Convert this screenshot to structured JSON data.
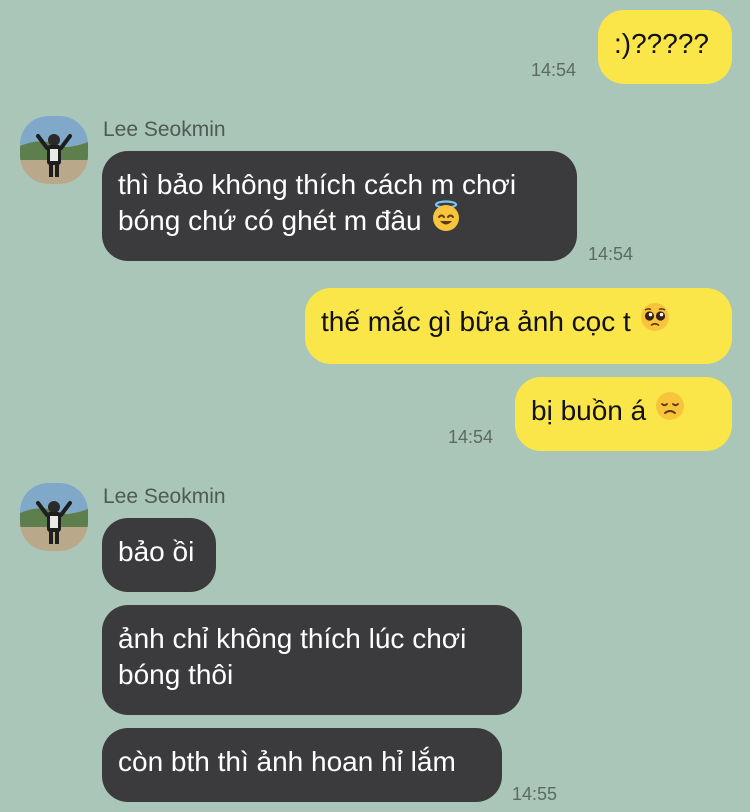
{
  "chat": {
    "messages": [
      {
        "text": ":)?????",
        "time": "14:54"
      },
      {
        "sender": "Lee Seokmin",
        "line1": "thì bảo không thích cách m chơi",
        "line2": "bóng chứ có ghét m đâu",
        "time": "14:54"
      },
      {
        "text": "thế mắc gì bữa ảnh cọc t"
      },
      {
        "text": "bị buồn á",
        "time": "14:54"
      },
      {
        "sender": "Lee Seokmin",
        "text": "bảo ồi"
      },
      {
        "line1": "ảnh chỉ không thích lúc chơi",
        "line2": "bóng thôi"
      },
      {
        "text": "còn bth thì ảnh hoan hỉ lắm",
        "time": "14:55"
      }
    ]
  },
  "emojis": {
    "smiling_face_with_halo": "smiling-face-with-halo-icon",
    "pleading_face": "pleading-face-icon",
    "disappointed_face": "disappointed-face-icon"
  },
  "colors": {
    "background": "#a9c6b8",
    "outgoing_bubble": "#fbe64a",
    "incoming_bubble": "#3b3b3d",
    "timestamp": "#5b6b63"
  }
}
